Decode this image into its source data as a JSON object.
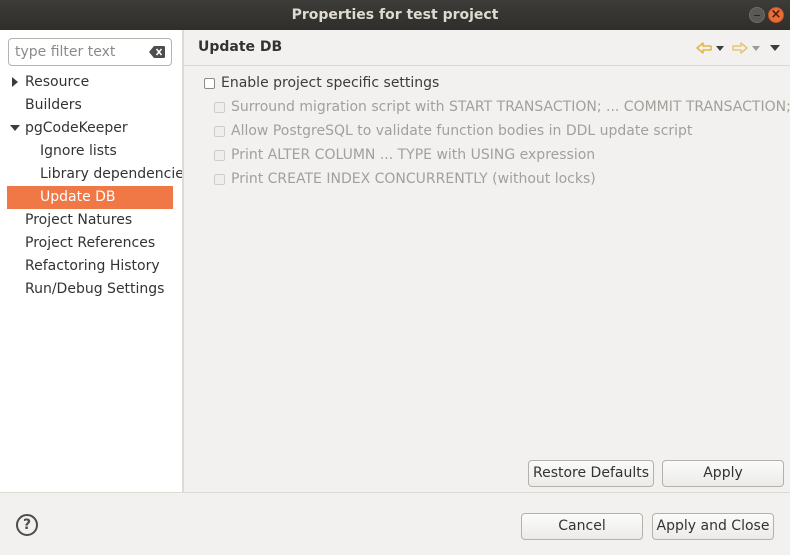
{
  "window": {
    "title": "Properties for test project"
  },
  "filter": {
    "placeholder": "type filter text",
    "value": ""
  },
  "tree": {
    "items": [
      {
        "label": "Resource",
        "expander": "collapsed"
      },
      {
        "label": "Builders"
      },
      {
        "label": "pgCodeKeeper",
        "expander": "expanded"
      },
      {
        "label": "Ignore lists"
      },
      {
        "label": "Library dependencies"
      },
      {
        "label": "Update DB",
        "selected": true
      },
      {
        "label": "Project Natures"
      },
      {
        "label": "Project References"
      },
      {
        "label": "Refactoring History"
      },
      {
        "label": "Run/Debug Settings"
      }
    ]
  },
  "page": {
    "title": "Update DB",
    "enable_label": "Enable project specific settings",
    "options": [
      {
        "label": "Surround migration script with START TRANSACTION; ... COMMIT TRANSACTION;",
        "checked": false,
        "enabled": false
      },
      {
        "label": "Allow PostgreSQL to validate function bodies in DDL update script",
        "checked": false,
        "enabled": false
      },
      {
        "label": "Print ALTER COLUMN ... TYPE with USING expression",
        "checked": false,
        "enabled": false
      },
      {
        "label": "Print CREATE INDEX CONCURRENTLY (without locks)",
        "checked": false,
        "enabled": false
      }
    ],
    "restore_label": "Restore Defaults",
    "apply_label": "Apply"
  },
  "footer": {
    "cancel_label": "Cancel",
    "apply_close_label": "Apply and Close",
    "help_icon": "?"
  },
  "icons": {
    "back": "arrow-left-icon",
    "forward": "arrow-right-icon",
    "menu": "chevron-down-icon",
    "clear": "clear-input-icon"
  },
  "colors": {
    "titlebar": "#3d3c38",
    "selection": "#f07746",
    "nav_arrow": "#e2b646",
    "close_button": "#e86d3a"
  }
}
